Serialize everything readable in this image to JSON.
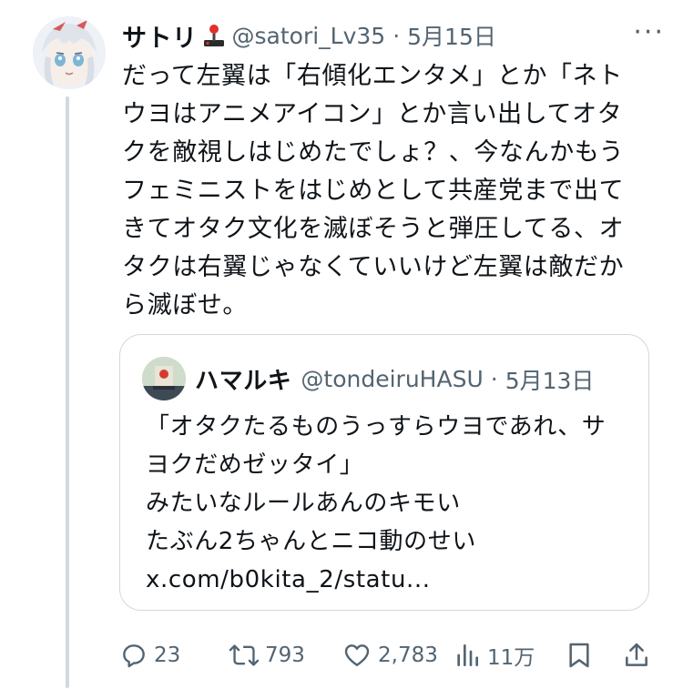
{
  "tweet": {
    "author_name": "サトリ",
    "handle": "@satori_Lv35",
    "separator": "·",
    "date": "5月15日",
    "more_label": "···",
    "text": "だって左翼は「右傾化エンタメ」とか「ネト\nウヨはアニメアイコン」とか言い出してオタ\nクを敵視しはじめたでしょ？、今なんかもう\nフェミニストをはじめとして共産党まで出て\nきてオタク文化を滅ぼそうと弾圧してる、オ\nタクは右翼じゃなくていいけど左翼は敵だか\nら滅ぼせ。"
  },
  "quoted": {
    "author_name": "ハマルキ",
    "handle": "@tondeiruHASU",
    "separator": "·",
    "date": "5月13日",
    "text": "「オタクたるものうっすらウヨであれ、サ\nヨクだめゼッタイ」\nみたいなルールあんのキモい\nたぶん2ちゃんとニコ動のせい\nx.com/b0kita_2/statu..."
  },
  "actions": {
    "replies": "23",
    "reposts": "793",
    "likes": "2,783",
    "views": "11万"
  },
  "icons": {
    "author_badge": "joystick-icon",
    "reply": "reply-icon",
    "repost": "repost-icon",
    "like": "heart-icon",
    "views": "views-icon",
    "bookmark": "bookmark-icon",
    "share": "share-icon"
  },
  "colors": {
    "text": "#0f1419",
    "secondary": "#536471",
    "border": "#cfd9de",
    "thread_line": "#d4d8dc"
  }
}
